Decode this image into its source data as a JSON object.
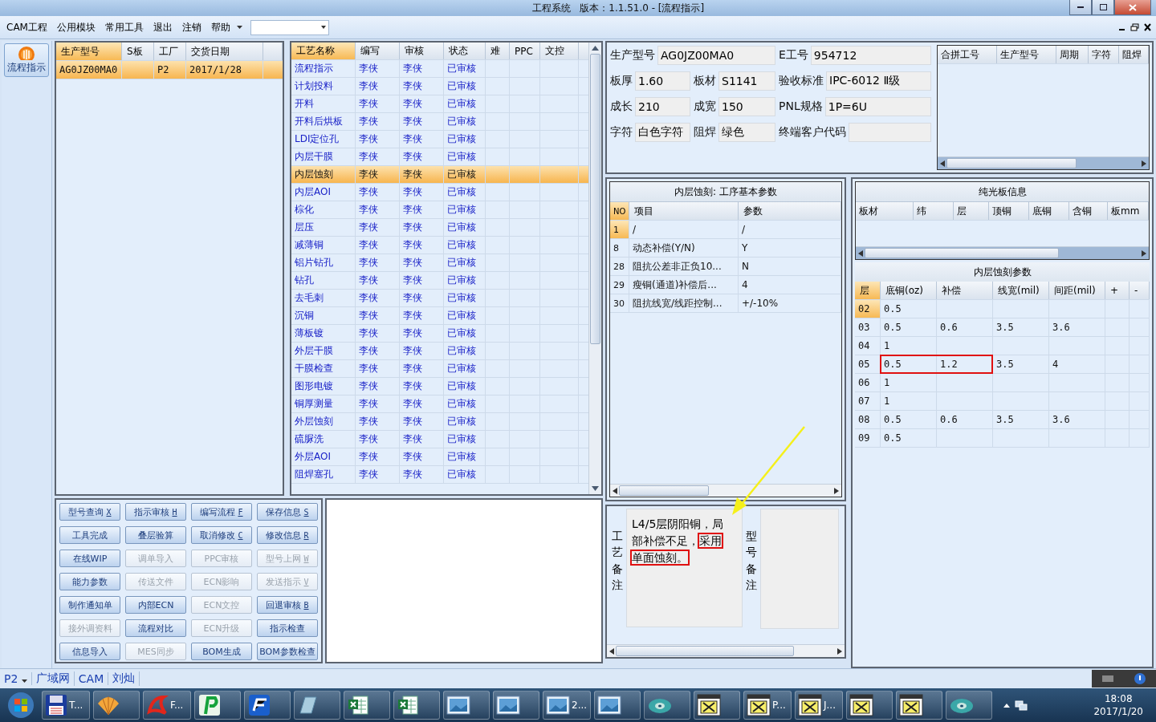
{
  "window": {
    "title": "工程系统   版本：1.1.51.0 - [流程指示]"
  },
  "menu": [
    "CAM工程",
    "公用模块",
    "常用工具",
    "退出",
    "注销",
    "帮助"
  ],
  "nav": {
    "label": "流程指示",
    "selected": true
  },
  "orders": {
    "columns": [
      "生产型号",
      "S板",
      "工厂",
      "交货日期"
    ],
    "rows": [
      {
        "cells": [
          "AG0JZ00MA0",
          "",
          "P2",
          "2017/1/28"
        ],
        "selected": true
      }
    ]
  },
  "process": {
    "columns": [
      "工艺名称",
      "编写",
      "审核",
      "状态",
      "难",
      "PPC",
      "文控"
    ],
    "rows": [
      {
        "cells": [
          "流程指示",
          "李侠",
          "李侠",
          "已审核"
        ],
        "selected": false
      },
      {
        "cells": [
          "计划投料",
          "李侠",
          "李侠",
          "已审核"
        ],
        "selected": false
      },
      {
        "cells": [
          "开料",
          "李侠",
          "李侠",
          "已审核"
        ],
        "selected": false
      },
      {
        "cells": [
          "开料后烘板",
          "李侠",
          "李侠",
          "已审核"
        ],
        "selected": false
      },
      {
        "cells": [
          "LDI定位孔",
          "李侠",
          "李侠",
          "已审核"
        ],
        "selected": false
      },
      {
        "cells": [
          "内层干膜",
          "李侠",
          "李侠",
          "已审核"
        ],
        "selected": false
      },
      {
        "cells": [
          "内层蚀刻",
          "李侠",
          "李侠",
          "已审核"
        ],
        "selected": true
      },
      {
        "cells": [
          "内层AOI",
          "李侠",
          "李侠",
          "已审核"
        ],
        "selected": false
      },
      {
        "cells": [
          "棕化",
          "李侠",
          "李侠",
          "已审核"
        ],
        "selected": false
      },
      {
        "cells": [
          "层压",
          "李侠",
          "李侠",
          "已审核"
        ],
        "selected": false
      },
      {
        "cells": [
          "减薄铜",
          "李侠",
          "李侠",
          "已审核"
        ],
        "selected": false
      },
      {
        "cells": [
          "铝片钻孔",
          "李侠",
          "李侠",
          "已审核"
        ],
        "selected": false
      },
      {
        "cells": [
          "钻孔",
          "李侠",
          "李侠",
          "已审核"
        ],
        "selected": false
      },
      {
        "cells": [
          "去毛刺",
          "李侠",
          "李侠",
          "已审核"
        ],
        "selected": false
      },
      {
        "cells": [
          "沉铜",
          "李侠",
          "李侠",
          "已审核"
        ],
        "selected": false
      },
      {
        "cells": [
          "薄板镀",
          "李侠",
          "李侠",
          "已审核"
        ],
        "selected": false
      },
      {
        "cells": [
          "外层干膜",
          "李侠",
          "李侠",
          "已审核"
        ],
        "selected": false
      },
      {
        "cells": [
          "干膜检查",
          "李侠",
          "李侠",
          "已审核"
        ],
        "selected": false
      },
      {
        "cells": [
          "图形电镀",
          "李侠",
          "李侠",
          "已审核"
        ],
        "selected": false
      },
      {
        "cells": [
          "铜厚测量",
          "李侠",
          "李侠",
          "已审核"
        ],
        "selected": false
      },
      {
        "cells": [
          "外层蚀刻",
          "李侠",
          "李侠",
          "已审核"
        ],
        "selected": false
      },
      {
        "cells": [
          "硫脲洗",
          "李侠",
          "李侠",
          "已审核"
        ],
        "selected": false
      },
      {
        "cells": [
          "外层AOI",
          "李侠",
          "李侠",
          "已审核"
        ],
        "selected": false
      },
      {
        "cells": [
          "阻焊塞孔",
          "李侠",
          "李侠",
          "已审核"
        ],
        "selected": false
      }
    ]
  },
  "buttons": [
    {
      "label": "型号查询",
      "key": "X",
      "disabled": false
    },
    {
      "label": "指示审核",
      "key": "H",
      "disabled": false
    },
    {
      "label": "编写流程",
      "key": "F",
      "disabled": false
    },
    {
      "label": "保存信息",
      "key": "S",
      "disabled": false
    },
    {
      "label": "工具完成",
      "disabled": false
    },
    {
      "label": "叠层验算",
      "disabled": false
    },
    {
      "label": "取消修改",
      "key": "C",
      "disabled": false
    },
    {
      "label": "修改信息",
      "key": "R",
      "disabled": false
    },
    {
      "label": "在线WIP",
      "disabled": false
    },
    {
      "label": "调单导入",
      "disabled": true
    },
    {
      "label": "PPC审核",
      "disabled": true
    },
    {
      "label": "型号上网",
      "key": "W",
      "disabled": true
    },
    {
      "label": "能力参数",
      "disabled": false
    },
    {
      "label": "传送文件",
      "disabled": true
    },
    {
      "label": "ECN影响",
      "disabled": true
    },
    {
      "label": "发送指示",
      "key": "V",
      "disabled": true
    },
    {
      "label": "制作通知单",
      "disabled": false
    },
    {
      "label": "内部ECN",
      "disabled": false
    },
    {
      "label": "ECN文控",
      "disabled": true
    },
    {
      "label": "回退审核",
      "key": "B",
      "disabled": false
    },
    {
      "label": "接外调资料",
      "disabled": true
    },
    {
      "label": "流程对比",
      "disabled": false
    },
    {
      "label": "ECN升级",
      "disabled": true
    },
    {
      "label": "指示检查",
      "disabled": false
    },
    {
      "label": "信息导入",
      "disabled": false
    },
    {
      "label": "MES同步",
      "disabled": true
    },
    {
      "label": "BOM生成",
      "disabled": false
    },
    {
      "label": "BOM参数检查",
      "disabled": false
    }
  ],
  "info": {
    "fields": [
      {
        "label": "生产型号",
        "value": "AG0JZ00MA0",
        "wide": true
      },
      {
        "label": "E工号",
        "value": "954712",
        "wide": false
      },
      {
        "label": "板厚",
        "value": "1.60",
        "wide": false
      },
      {
        "label": "板材",
        "value": "S1141",
        "wide": false
      },
      {
        "label": "验收标准",
        "value": "IPC-6012 Ⅱ级",
        "wide": false
      },
      {
        "label": "成长",
        "value": "210",
        "wide": false
      },
      {
        "label": "成宽",
        "value": "150",
        "wide": false
      },
      {
        "label": "PNL规格",
        "value": "1P=6U",
        "wide": false
      },
      {
        "label": "字符",
        "value": "白色字符",
        "wide": false
      },
      {
        "label": "阻焊",
        "value": "绿色",
        "wide": false
      },
      {
        "label": "终端客户代码",
        "wide": false
      }
    ]
  },
  "merge_table": {
    "columns": [
      "合拼工号",
      "生产型号",
      "周期",
      "字符",
      "阻焊"
    ]
  },
  "step_params": {
    "title": "内层蚀刻: 工序基本参数",
    "columns": [
      "NO",
      "项目",
      "参数"
    ],
    "rows": [
      {
        "cells": [
          "1",
          "/",
          "/"
        ],
        "selected": true
      },
      {
        "cells": [
          "8",
          "动态补偿(Y/N)",
          "Y"
        ],
        "selected": false
      },
      {
        "cells": [
          "28",
          "阻抗公差非正负10...",
          "N"
        ],
        "selected": false
      },
      {
        "cells": [
          "29",
          "瘦铜(通道)补偿后...",
          "4"
        ],
        "selected": false
      },
      {
        "cells": [
          "30",
          "阻抗线宽/线距控制...",
          "+/-10%"
        ],
        "selected": false
      }
    ]
  },
  "bare_board": {
    "title": "纯光板信息",
    "columns": [
      "板材",
      "纬",
      "层",
      "顶铜",
      "底铜",
      "含铜",
      "板mm"
    ]
  },
  "etch_params": {
    "title": "内层蚀刻参数",
    "columns": [
      "层",
      "底铜(oz)",
      "补偿",
      "线宽(mil)",
      "间距(mil)",
      "+",
      "-"
    ],
    "rows": [
      {
        "cells": [
          "02",
          "0.5",
          "",
          "",
          ""
        ],
        "selected": true,
        "highlighted": false
      },
      {
        "cells": [
          "03",
          "0.5",
          "0.6",
          "3.5",
          "3.6"
        ],
        "selected": false,
        "highlighted": false
      },
      {
        "cells": [
          "04",
          "1",
          "",
          "",
          ""
        ],
        "selected": false,
        "highlighted": false
      },
      {
        "cells": [
          "05",
          "0.5",
          "1.2",
          "3.5",
          "4"
        ],
        "selected": false,
        "highlighted": true
      },
      {
        "cells": [
          "06",
          "1",
          "",
          "",
          ""
        ],
        "selected": false,
        "highlighted": false
      },
      {
        "cells": [
          "07",
          "1",
          "",
          "",
          ""
        ],
        "selected": false,
        "highlighted": false
      },
      {
        "cells": [
          "08",
          "0.5",
          "0.6",
          "3.5",
          "3.6"
        ],
        "selected": false,
        "highlighted": false
      },
      {
        "cells": [
          "09",
          "0.5",
          "",
          "",
          ""
        ],
        "selected": false,
        "highlighted": false
      }
    ]
  },
  "notes": {
    "process_label": "工艺备注",
    "process_note": [
      {
        "text": "L4/5层阴阳铜，局部补偿不足，",
        "highlighted": false
      },
      {
        "text": "采用",
        "highlighted": true
      },
      {
        "text": "单面蚀刻。",
        "highlighted": true
      }
    ],
    "model_label": "型号备注"
  },
  "status_bar": {
    "plant": "P2",
    "items": [
      "广域网",
      "CAM",
      "刘灿"
    ]
  },
  "taskbar": {
    "items": [
      {
        "kind": "disk",
        "label": "T..."
      },
      {
        "kind": "shell"
      },
      {
        "kind": "pdf",
        "label": "F..."
      },
      {
        "kind": "pcb"
      },
      {
        "kind": "mail"
      },
      {
        "kind": "book"
      },
      {
        "kind": "sheet"
      },
      {
        "kind": "sheet"
      },
      {
        "kind": "photo"
      },
      {
        "kind": "photo"
      },
      {
        "kind": "photo",
        "label": "2..."
      },
      {
        "kind": "photo"
      },
      {
        "kind": "disc"
      },
      {
        "kind": "window"
      },
      {
        "kind": "window",
        "label": "P..."
      },
      {
        "kind": "window",
        "label": "J..."
      },
      {
        "kind": "window"
      },
      {
        "kind": "window"
      },
      {
        "kind": "disc"
      }
    ],
    "time": "18:08",
    "date": "2017/1/20"
  }
}
